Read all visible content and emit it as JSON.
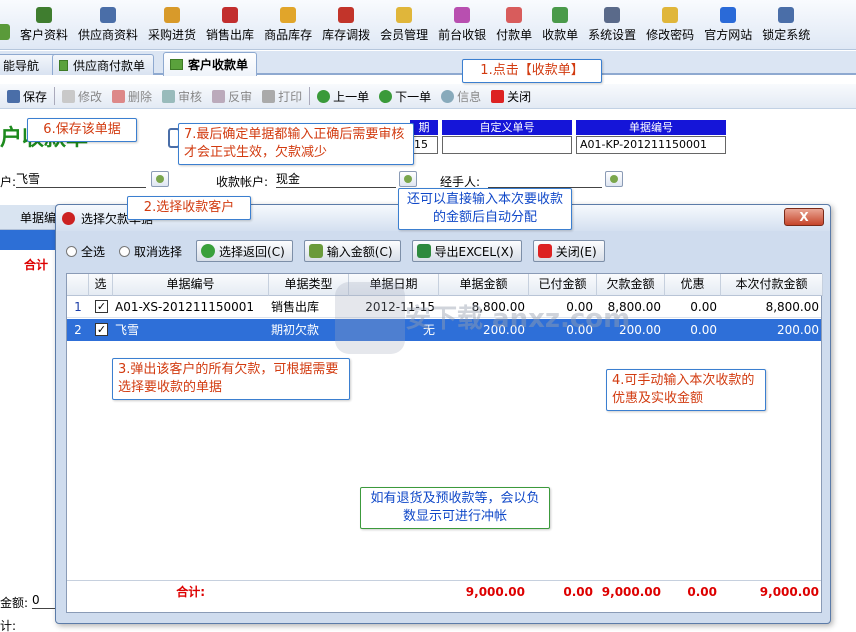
{
  "menu": [
    {
      "label": "",
      "icon": "cut-icon",
      "color": "#5a9a3a"
    },
    {
      "label": "客户资料",
      "icon": "customer-icon",
      "color": "#3f7d2f"
    },
    {
      "label": "供应商资料",
      "icon": "supplier-icon",
      "color": "#4a6ea8"
    },
    {
      "label": "采购进货",
      "icon": "purchase-icon",
      "color": "#d89a2a"
    },
    {
      "label": "销售出库",
      "icon": "sales-icon",
      "color": "#c22e2e"
    },
    {
      "label": "商品库存",
      "icon": "stock-icon",
      "color": "#e1a52a"
    },
    {
      "label": "库存调拨",
      "icon": "transfer-icon",
      "color": "#c2342a"
    },
    {
      "label": "会员管理",
      "icon": "member-icon",
      "color": "#e0b63a"
    },
    {
      "label": "前台收银",
      "icon": "cashier-icon",
      "color": "#b84fb0"
    },
    {
      "label": "付款单",
      "icon": "payment-icon",
      "color": "#d85c5c"
    },
    {
      "label": "收款单",
      "icon": "receipt-icon",
      "color": "#4a9a4a"
    },
    {
      "label": "系统设置",
      "icon": "settings-icon",
      "color": "#5a6a8a"
    },
    {
      "label": "修改密码",
      "icon": "password-icon",
      "color": "#e0b63a"
    },
    {
      "label": "官方网站",
      "icon": "website-icon",
      "color": "#2a6ad8"
    },
    {
      "label": "锁定系统",
      "icon": "lock-icon",
      "color": "#4a6ea8"
    }
  ],
  "tabs": [
    "能导航",
    "供应商付款单",
    "客户收款单"
  ],
  "toolbar": {
    "save": "保存",
    "edit": "修改",
    "delete": "删除",
    "audit": "审核",
    "unaudit": "反审",
    "print": "打印",
    "prev": "上一单",
    "next": "下一单",
    "info": "信息",
    "close": "关闭"
  },
  "form": {
    "title": "户收款单",
    "date_header": "期",
    "date_value": "15",
    "custom_no_header": "自定义单号",
    "doc_no_header": "单据编号",
    "doc_no_value": "A01-KP-201211150001",
    "customer_label": "户:",
    "customer_value": "飞雪",
    "account_label": "收款帐户:",
    "account_value": "现金",
    "handler_label": "经手人:",
    "grid_header_left": "单据编",
    "total_label": "合计",
    "amount_label": "金额:",
    "amount_value": "0",
    "bottom_label": "计:"
  },
  "dialog": {
    "title": "选择欠款单据",
    "close": "X",
    "select_all": "全选",
    "deselect": "取消选择",
    "btn_return": "选择返回(C)",
    "btn_input": "输入金额(C)",
    "btn_export": "导出EXCEL(X)",
    "btn_close": "关闭(E)",
    "columns": [
      "选",
      "单据编号",
      "单据类型",
      "单据日期",
      "单据金额",
      "已付金额",
      "欠款金额",
      "优惠",
      "本次付款金额"
    ],
    "rows": [
      {
        "n": "1",
        "checked": "✓",
        "doc_no": "A01-XS-201211150001",
        "type": "销售出库",
        "date": "2012-11-15",
        "amount": "8,800.00",
        "paid": "0.00",
        "owed": "8,800.00",
        "discount": "0.00",
        "pay": "8,800.00"
      },
      {
        "n": "2",
        "checked": "✓",
        "doc_no": "飞雪",
        "type": "期初欠款",
        "date": "无",
        "amount": "200.00",
        "paid": "0.00",
        "owed": "200.00",
        "discount": "0.00",
        "pay": "200.00"
      }
    ],
    "total_label": "合计:",
    "totals": {
      "amount": "9,000.00",
      "paid": "0.00",
      "owed": "9,000.00",
      "discount": "0.00",
      "pay": "9,000.00"
    }
  },
  "callouts": {
    "c1": "1.点击【收款单】",
    "c2": "2.选择收款客户",
    "c3": "3.弹出该客户的所有欠款，可根据需要选择要收款的单据",
    "c4": "4.可手动输入本次收款的优惠及实收金额",
    "c5": "还可以直接输入本次要收款的金额后自动分配",
    "c6": "6.保存该单据",
    "c7": "7.最后确定单据都输入正确后需要审核才会正式生效，欠款减少",
    "c8": "如有退货及预收款等，会以负数显示可进行冲帐"
  },
  "watermark": "安下载 anxz.com"
}
